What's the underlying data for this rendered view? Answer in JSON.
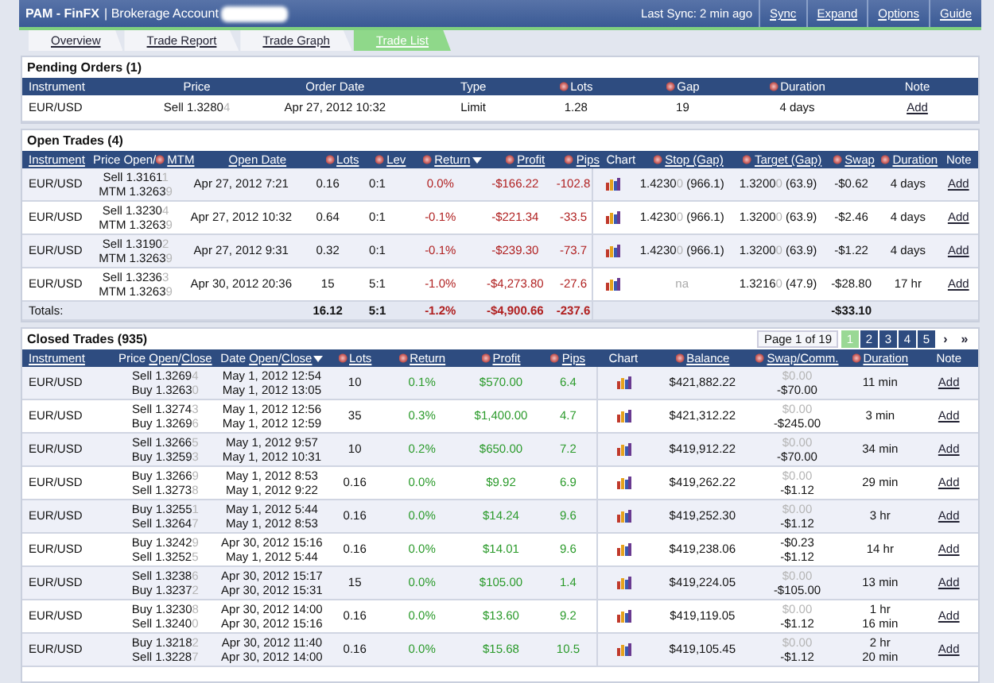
{
  "header": {
    "brand": "PAM - FinFX",
    "account": "| Brokerage Account",
    "sync": "Last Sync: 2 min ago",
    "buttons": [
      "Sync",
      "Expand",
      "Options",
      "Guide"
    ]
  },
  "tabs": [
    {
      "label": "Overview",
      "selected": false
    },
    {
      "label": "Trade Report",
      "selected": false
    },
    {
      "label": "Trade Graph",
      "selected": false
    },
    {
      "label": "Trade List",
      "selected": true
    }
  ],
  "pending": {
    "title": "Pending Orders (1)",
    "columns": [
      {
        "segments": [
          {
            "text": "Instrument",
            "link": false,
            "sortable": false
          }
        ],
        "sorted": false
      },
      {
        "segments": [
          {
            "text": "Price",
            "link": false,
            "sortable": false
          }
        ],
        "sorted": false
      },
      {
        "segments": [
          {
            "text": "Order Date",
            "link": false,
            "sortable": false
          }
        ],
        "sorted": false
      },
      {
        "segments": [
          {
            "text": "Type",
            "link": false,
            "sortable": false
          }
        ],
        "sorted": false
      },
      {
        "segments": [
          {
            "text": "Lots",
            "link": false,
            "sortable": true
          }
        ],
        "sorted": false
      },
      {
        "segments": [
          {
            "text": "Gap",
            "link": false,
            "sortable": true
          }
        ],
        "sorted": false
      },
      {
        "segments": [
          {
            "text": "Duration",
            "link": false,
            "sortable": true
          }
        ],
        "sorted": false
      },
      {
        "segments": [
          {
            "text": "Note",
            "link": false,
            "sortable": false
          }
        ],
        "sorted": false
      }
    ],
    "rows": [
      {
        "instrument": "EUR/USD",
        "price": {
          "text": "Sell 1.3280",
          "pip": "4"
        },
        "date": "Apr 27, 2012 10:32",
        "type": "Limit",
        "lots": "1.28",
        "gap": "19",
        "duration": "4 days",
        "note": "Add"
      }
    ]
  },
  "open": {
    "title": "Open Trades (4)",
    "columns": [
      {
        "segments": [
          {
            "text": "Instrument",
            "link": true,
            "sortable": false
          }
        ],
        "sorted": false
      },
      {
        "segments": [
          {
            "text": "Price Open/",
            "link": false,
            "sortable": false
          },
          {
            "text": "MTM",
            "link": true,
            "sortable": true
          }
        ],
        "sorted": false
      },
      {
        "segments": [
          {
            "text": "Open Date",
            "link": true,
            "sortable": false
          }
        ],
        "sorted": false
      },
      {
        "segments": [
          {
            "text": "Lots",
            "link": true,
            "sortable": true
          }
        ],
        "sorted": false
      },
      {
        "segments": [
          {
            "text": "Lev",
            "link": true,
            "sortable": true
          }
        ],
        "sorted": false
      },
      {
        "segments": [
          {
            "text": "Return",
            "link": true,
            "sortable": true
          }
        ],
        "sorted": true
      },
      {
        "segments": [
          {
            "text": "Profit",
            "link": true,
            "sortable": true
          }
        ],
        "sorted": false
      },
      {
        "segments": [
          {
            "text": "Pips",
            "link": true,
            "sortable": true
          }
        ],
        "sorted": false
      },
      {
        "segments": [
          {
            "text": "Chart",
            "link": false,
            "sortable": false
          }
        ],
        "sorted": false
      },
      {
        "segments": [
          {
            "text": "Stop (Gap)",
            "link": true,
            "sortable": true
          }
        ],
        "sorted": false
      },
      {
        "segments": [
          {
            "text": "Target (Gap)",
            "link": true,
            "sortable": true
          }
        ],
        "sorted": false
      },
      {
        "segments": [
          {
            "text": "Swap",
            "link": true,
            "sortable": true
          }
        ],
        "sorted": false
      },
      {
        "segments": [
          {
            "text": "Duration",
            "link": true,
            "sortable": true
          }
        ],
        "sorted": false
      },
      {
        "segments": [
          {
            "text": "Note",
            "link": false,
            "sortable": false
          }
        ],
        "sorted": false
      }
    ],
    "rows": [
      {
        "instrument": "EUR/USD",
        "open": {
          "text": "Sell 1.3161",
          "pip": "1"
        },
        "mtm": {
          "text": "MTM 1.3263",
          "pip": "9"
        },
        "date": "Apr 27, 2012 7:21",
        "lots": "0.16",
        "lev": "0:1",
        "return": "0.0%",
        "profit": "-$166.22",
        "pips": "-102.8",
        "loss": true,
        "stop": {
          "text": "1.4230",
          "pip": "0",
          "gap": "(966.1)",
          "muted": false
        },
        "target": {
          "text": "1.3200",
          "pip": "0",
          "gap": "(63.9)"
        },
        "swap": "-$0.62",
        "duration": "4 days",
        "note": "Add"
      },
      {
        "instrument": "EUR/USD",
        "open": {
          "text": "Sell 1.3230",
          "pip": "4"
        },
        "mtm": {
          "text": "MTM 1.3263",
          "pip": "9"
        },
        "date": "Apr 27, 2012 10:32",
        "lots": "0.64",
        "lev": "0:1",
        "return": "-0.1%",
        "profit": "-$221.34",
        "pips": "-33.5",
        "loss": true,
        "stop": {
          "text": "1.4230",
          "pip": "0",
          "gap": "(966.1)",
          "muted": false
        },
        "target": {
          "text": "1.3200",
          "pip": "0",
          "gap": "(63.9)"
        },
        "swap": "-$2.46",
        "duration": "4 days",
        "note": "Add"
      },
      {
        "instrument": "EUR/USD",
        "open": {
          "text": "Sell 1.3190",
          "pip": "2"
        },
        "mtm": {
          "text": "MTM 1.3263",
          "pip": "9"
        },
        "date": "Apr 27, 2012 9:31",
        "lots": "0.32",
        "lev": "0:1",
        "return": "-0.1%",
        "profit": "-$239.30",
        "pips": "-73.7",
        "loss": true,
        "stop": {
          "text": "1.4230",
          "pip": "0",
          "gap": "(966.1)",
          "muted": false
        },
        "target": {
          "text": "1.3200",
          "pip": "0",
          "gap": "(63.9)"
        },
        "swap": "-$1.22",
        "duration": "4 days",
        "note": "Add"
      },
      {
        "instrument": "EUR/USD",
        "open": {
          "text": "Sell 1.3236",
          "pip": "3"
        },
        "mtm": {
          "text": "MTM 1.3263",
          "pip": "9"
        },
        "date": "Apr 30, 2012 20:36",
        "lots": "15",
        "lev": "5:1",
        "return": "-1.0%",
        "profit": "-$4,273.80",
        "pips": "-27.6",
        "loss": true,
        "stop": {
          "text": "na",
          "muted": true
        },
        "target": {
          "text": "1.3216",
          "pip": "0",
          "gap": "(47.9)"
        },
        "swap": "-$28.80",
        "duration": "17 hr",
        "note": "Add"
      }
    ],
    "totals": {
      "label": "Totals:",
      "lots": "16.12",
      "lev": "5:1",
      "return": "-1.2%",
      "profit": "-$4,900.66",
      "pips": "-237.6",
      "loss": true,
      "swap": "-$33.10"
    }
  },
  "closed": {
    "title": "Closed Trades (935)",
    "pager": {
      "label": "Page 1 of 19",
      "pages": [
        {
          "label": "1",
          "selected": true
        },
        {
          "label": "2",
          "selected": false
        },
        {
          "label": "3",
          "selected": false
        },
        {
          "label": "4",
          "selected": false
        },
        {
          "label": "5",
          "selected": false
        }
      ],
      "next": "›",
      "last": "»"
    },
    "columns": [
      {
        "segments": [
          {
            "text": "Instrument",
            "link": true,
            "sortable": false
          }
        ],
        "sorted": false
      },
      {
        "segments": [
          {
            "text": "Price ",
            "link": false,
            "sortable": false
          },
          {
            "text": "Open",
            "link": true,
            "sortable": false
          },
          {
            "text": "/",
            "link": false,
            "sortable": false
          },
          {
            "text": "Close",
            "link": true,
            "sortable": false
          }
        ],
        "sorted": false
      },
      {
        "segments": [
          {
            "text": "Date ",
            "link": false,
            "sortable": false
          },
          {
            "text": "Open",
            "link": true,
            "sortable": false
          },
          {
            "text": "/",
            "link": false,
            "sortable": false
          },
          {
            "text": "Close",
            "link": true,
            "sortable": false
          }
        ],
        "sorted": true
      },
      {
        "segments": [
          {
            "text": "Lots",
            "link": true,
            "sortable": true
          }
        ],
        "sorted": false
      },
      {
        "segments": [
          {
            "text": "Return",
            "link": true,
            "sortable": true
          }
        ],
        "sorted": false
      },
      {
        "segments": [
          {
            "text": "Profit",
            "link": true,
            "sortable": true
          }
        ],
        "sorted": false
      },
      {
        "segments": [
          {
            "text": "Pips",
            "link": true,
            "sortable": true
          }
        ],
        "sorted": false
      },
      {
        "segments": [
          {
            "text": "Chart",
            "link": false,
            "sortable": false
          }
        ],
        "sorted": false
      },
      {
        "segments": [
          {
            "text": "Balance",
            "link": true,
            "sortable": true
          }
        ],
        "sorted": false
      },
      {
        "segments": [
          {
            "text": "Swap/Comm.",
            "link": true,
            "sortable": true
          }
        ],
        "sorted": false
      },
      {
        "segments": [
          {
            "text": "Duration",
            "link": true,
            "sortable": true
          }
        ],
        "sorted": false
      },
      {
        "segments": [
          {
            "text": "Note",
            "link": false,
            "sortable": false
          }
        ],
        "sorted": false
      }
    ],
    "rows": [
      {
        "instrument": "EUR/USD",
        "prices": [
          {
            "text": "Sell 1.3269",
            "pip": "4"
          },
          {
            "text": "Buy 1.3263",
            "pip": "0"
          }
        ],
        "dates": [
          "May 1, 2012 12:54",
          "May 1, 2012 13:05"
        ],
        "lots": "10",
        "return": "0.1%",
        "profit": "$570.00",
        "pips": "6.4",
        "loss": false,
        "balance": "$421,882.22",
        "swap": "$0.00",
        "swap_muted": true,
        "comm": "-$70.00",
        "duration": [
          "11 min"
        ],
        "note": "Add"
      },
      {
        "instrument": "EUR/USD",
        "prices": [
          {
            "text": "Sell 1.3274",
            "pip": "3"
          },
          {
            "text": "Buy 1.3269",
            "pip": "6"
          }
        ],
        "dates": [
          "May 1, 2012 12:56",
          "May 1, 2012 12:59"
        ],
        "lots": "35",
        "return": "0.3%",
        "profit": "$1,400.00",
        "pips": "4.7",
        "loss": false,
        "balance": "$421,312.22",
        "swap": "$0.00",
        "swap_muted": true,
        "comm": "-$245.00",
        "duration": [
          "3 min"
        ],
        "note": "Add"
      },
      {
        "instrument": "EUR/USD",
        "prices": [
          {
            "text": "Sell 1.3266",
            "pip": "5"
          },
          {
            "text": "Buy 1.3259",
            "pip": "3"
          }
        ],
        "dates": [
          "May 1, 2012 9:57",
          "May 1, 2012 10:31"
        ],
        "lots": "10",
        "return": "0.2%",
        "profit": "$650.00",
        "pips": "7.2",
        "loss": false,
        "balance": "$419,912.22",
        "swap": "$0.00",
        "swap_muted": true,
        "comm": "-$70.00",
        "duration": [
          "34 min"
        ],
        "note": "Add"
      },
      {
        "instrument": "EUR/USD",
        "prices": [
          {
            "text": "Buy 1.3266",
            "pip": "9"
          },
          {
            "text": "Sell 1.3273",
            "pip": "8"
          }
        ],
        "dates": [
          "May 1, 2012 8:53",
          "May 1, 2012 9:22"
        ],
        "lots": "0.16",
        "return": "0.0%",
        "profit": "$9.92",
        "pips": "6.9",
        "loss": false,
        "balance": "$419,262.22",
        "swap": "$0.00",
        "swap_muted": true,
        "comm": "-$1.12",
        "duration": [
          "29 min"
        ],
        "note": "Add"
      },
      {
        "instrument": "EUR/USD",
        "prices": [
          {
            "text": "Buy 1.3255",
            "pip": "1"
          },
          {
            "text": "Sell 1.3264",
            "pip": "7"
          }
        ],
        "dates": [
          "May 1, 2012 5:44",
          "May 1, 2012 8:53"
        ],
        "lots": "0.16",
        "return": "0.0%",
        "profit": "$14.24",
        "pips": "9.6",
        "loss": false,
        "balance": "$419,252.30",
        "swap": "$0.00",
        "swap_muted": true,
        "comm": "-$1.12",
        "duration": [
          "3 hr"
        ],
        "note": "Add"
      },
      {
        "instrument": "EUR/USD",
        "prices": [
          {
            "text": "Buy 1.3242",
            "pip": "9"
          },
          {
            "text": "Sell 1.3252",
            "pip": "5"
          }
        ],
        "dates": [
          "Apr 30, 2012 15:16",
          "May 1, 2012 5:44"
        ],
        "lots": "0.16",
        "return": "0.0%",
        "profit": "$14.01",
        "pips": "9.6",
        "loss": false,
        "balance": "$419,238.06",
        "swap": "-$0.23",
        "swap_muted": false,
        "comm": "-$1.12",
        "duration": [
          "14 hr"
        ],
        "note": "Add"
      },
      {
        "instrument": "EUR/USD",
        "prices": [
          {
            "text": "Sell 1.3238",
            "pip": "6"
          },
          {
            "text": "Buy 1.3237",
            "pip": "2"
          }
        ],
        "dates": [
          "Apr 30, 2012 15:17",
          "Apr 30, 2012 15:31"
        ],
        "lots": "15",
        "return": "0.0%",
        "profit": "$105.00",
        "pips": "1.4",
        "loss": false,
        "balance": "$419,224.05",
        "swap": "$0.00",
        "swap_muted": true,
        "comm": "-$105.00",
        "duration": [
          "13 min"
        ],
        "note": "Add"
      },
      {
        "instrument": "EUR/USD",
        "prices": [
          {
            "text": "Buy 1.3230",
            "pip": "8"
          },
          {
            "text": "Sell 1.3240",
            "pip": "0"
          }
        ],
        "dates": [
          "Apr 30, 2012 14:00",
          "Apr 30, 2012 15:16"
        ],
        "lots": "0.16",
        "return": "0.0%",
        "profit": "$13.60",
        "pips": "9.2",
        "loss": false,
        "balance": "$419,119.05",
        "swap": "$0.00",
        "swap_muted": true,
        "comm": "-$1.12",
        "duration": [
          "1 hr",
          "16 min"
        ],
        "note": "Add"
      },
      {
        "instrument": "EUR/USD",
        "prices": [
          {
            "text": "Buy 1.3218",
            "pip": "2"
          },
          {
            "text": "Sell 1.3228",
            "pip": "7"
          }
        ],
        "dates": [
          "Apr 30, 2012 11:40",
          "Apr 30, 2012 14:00"
        ],
        "lots": "0.16",
        "return": "0.0%",
        "profit": "$15.68",
        "pips": "10.5",
        "loss": false,
        "balance": "$419,105.45",
        "swap": "$0.00",
        "swap_muted": true,
        "comm": "-$1.12",
        "duration": [
          "2 hr",
          "20 min"
        ],
        "note": "Add"
      }
    ]
  }
}
